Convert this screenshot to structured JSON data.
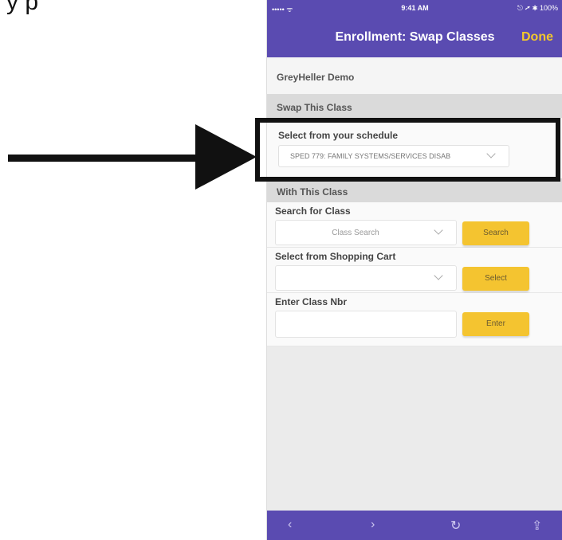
{
  "top_text": "y            p",
  "status_bar": {
    "left": "••••• ᯤ",
    "time": "9:41 AM",
    "right": "⎋ ➚ ✱ 100%"
  },
  "nav": {
    "title": "Enrollment: Swap Classes",
    "done_label": "Done"
  },
  "org": "GreyHeller Demo",
  "swap_section": {
    "header": "Swap This Class",
    "select_label": "Select from your schedule",
    "selected_value": "SPED 779: FAMILY SYSTEMS/SERVICES DISAB"
  },
  "with_section": {
    "header": "With This Class",
    "search": {
      "label": "Search for Class",
      "placeholder": "Class Search",
      "button": "Search"
    },
    "cart": {
      "label": "Select from Shopping Cart",
      "placeholder": "",
      "button": "Select"
    },
    "class_nbr": {
      "label": "Enter Class Nbr",
      "value": "",
      "button": "Enter"
    }
  },
  "tabbar": {
    "back_icon": "chevron-left-icon",
    "forward_icon": "chevron-right-icon",
    "refresh_icon": "refresh-icon",
    "share_icon": "share-icon"
  },
  "colors": {
    "nav_purple": "#5a4bb1",
    "accent_yellow": "#f4c430",
    "done_gold": "#f2c72c"
  }
}
